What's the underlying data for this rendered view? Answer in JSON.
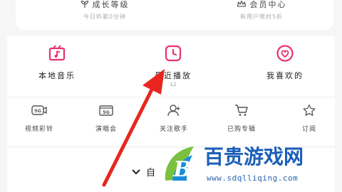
{
  "top_card": {
    "growth": {
      "title": "成长等级",
      "subtitle": "今日听歌0分钟"
    },
    "vip": {
      "title": "会员中心",
      "subtitle": "新用户限时5折"
    }
  },
  "quick_access": [
    {
      "label": "本地音乐",
      "icon": "local-music-icon"
    },
    {
      "label": "最近播放",
      "count": "12",
      "icon": "recent-play-icon"
    },
    {
      "label": "我喜欢的",
      "icon": "favorite-heart-icon"
    }
  ],
  "services": [
    {
      "label": "视频彩铃",
      "icon": "video-ringtone-5g-icon"
    },
    {
      "label": "演唱会",
      "icon": "concert-5g-icon"
    },
    {
      "label": "关注歌手",
      "icon": "follow-artist-icon"
    },
    {
      "label": "已购专辑",
      "icon": "purchased-album-cart-icon"
    },
    {
      "label": "订阅",
      "icon": "subscription-star-icon"
    }
  ],
  "playlist_section": {
    "label": "自",
    "icon": "chevron-down-icon"
  },
  "watermark": {
    "logo_letter": "B",
    "name": "百贵游戏网",
    "url": "www.sdqlliqing.com"
  },
  "colors": {
    "accent": "#e8336e",
    "icon_gray": "#555555",
    "arrow_red": "#e8261f",
    "watermark_blue": "#1b5fb8",
    "watermark_green": "#7ac142"
  }
}
